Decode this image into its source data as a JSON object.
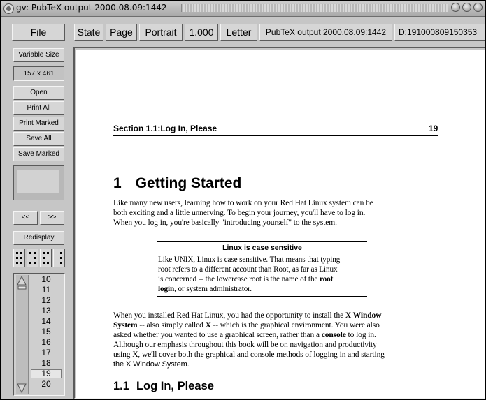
{
  "window": {
    "title": "gv: PubTeX output 2000.08.09:1442"
  },
  "toolbar": {
    "file": "File",
    "state": "State",
    "page": "Page",
    "orientation": "Portrait",
    "scale": "1.000",
    "media": "Letter",
    "document_title": "PubTeX output 2000.08.09:1442",
    "date": "D:191000809150353"
  },
  "sidebar": {
    "variable_size": "Variable Size",
    "size_readout": "157 x 461",
    "open": "Open",
    "print_all": "Print All",
    "print_marked": "Print Marked",
    "save_all": "Save All",
    "save_marked": "Save Marked",
    "prev": "<<",
    "next": ">>",
    "redisplay": "Redisplay"
  },
  "page_list": {
    "pages": [
      "10",
      "11",
      "12",
      "13",
      "14",
      "15",
      "16",
      "17",
      "18",
      "19",
      "20"
    ],
    "current": "19"
  },
  "document": {
    "running_head": "Section 1.1:Log In, Please",
    "page_number": "19",
    "chapter_number": "1",
    "chapter_title": "Getting Started",
    "intro": [
      "Like many new users, learning how to work on your Red Hat Linux system can be",
      "both exciting and a little unnerving.  To begin your journey, you'll have to log in.",
      "When you log in, you're basically \"introducing yourself\" to the system."
    ],
    "note": {
      "title": "Linux is case sensitive",
      "line1": "Like UNIX, Linux is case sensitive. That means that typing",
      "line2": "root refers to a different account than Root, as far as Linux",
      "line3": "is concerned -- the lowercase root is the name of the ",
      "line3_bold": "root",
      "line4_bold": "login",
      "line4": ", or system administrator."
    },
    "para2": {
      "l1": "When you installed Red Hat Linux, you had the opportunity to install the ",
      "l1_bold": "X Window",
      "l2_bold": "System",
      "l2": " -- also simply called ",
      "l2_bold2": "X",
      "l2b": " -- which is the graphical environment. You were also",
      "l3": "asked whether you wanted to use a graphical screen, rather than a ",
      "l3_bold": "console",
      "l3b": " to log in.",
      "l4": "Although our emphasis throughout this book will be on navigation and productivity",
      "l5": "using X, we'll cover both the graphical and console methods of logging in and starting",
      "l6": "the X Window System."
    },
    "section_number": "1.1",
    "section_title": "Log In, Please"
  }
}
